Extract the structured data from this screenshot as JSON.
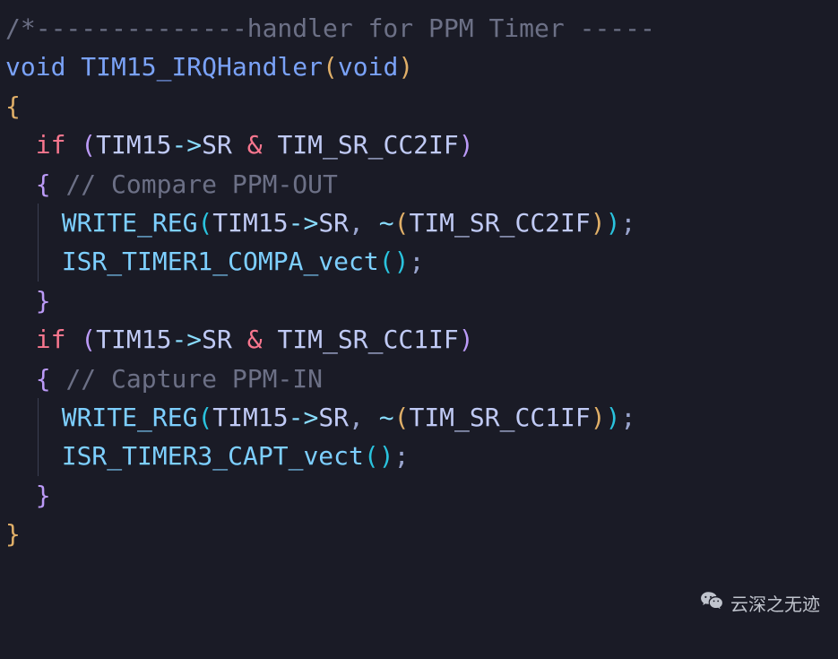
{
  "code": {
    "line1_comment_prefix": "/*--------------",
    "line1_comment_text": "handler for PPM Timer -----",
    "kw_void": "void",
    "fn_name": "TIM15_IRQHandler",
    "param_void": "void",
    "kw_if": "if",
    "expr_obj": "TIM15",
    "arrow": "->",
    "prop_sr": "SR",
    "op_and": "&",
    "flag_cc2if": "TIM_SR_CC2IF",
    "flag_cc1if": "TIM_SR_CC1IF",
    "cmt_compare": "// Compare PPM-OUT",
    "cmt_capture": "// Capture PPM-IN",
    "call_write_reg": "WRITE_REG",
    "op_not": "~",
    "call_isr_compa": "ISR_TIMER1_COMPA_vect",
    "call_isr_capt": "ISR_TIMER3_CAPT_vect",
    "semi": ";",
    "comma": ",",
    "lbrace": "{",
    "rbrace": "}",
    "lparen": "(",
    "rparen": ")"
  },
  "watermark": {
    "text": "云深之无迹"
  }
}
